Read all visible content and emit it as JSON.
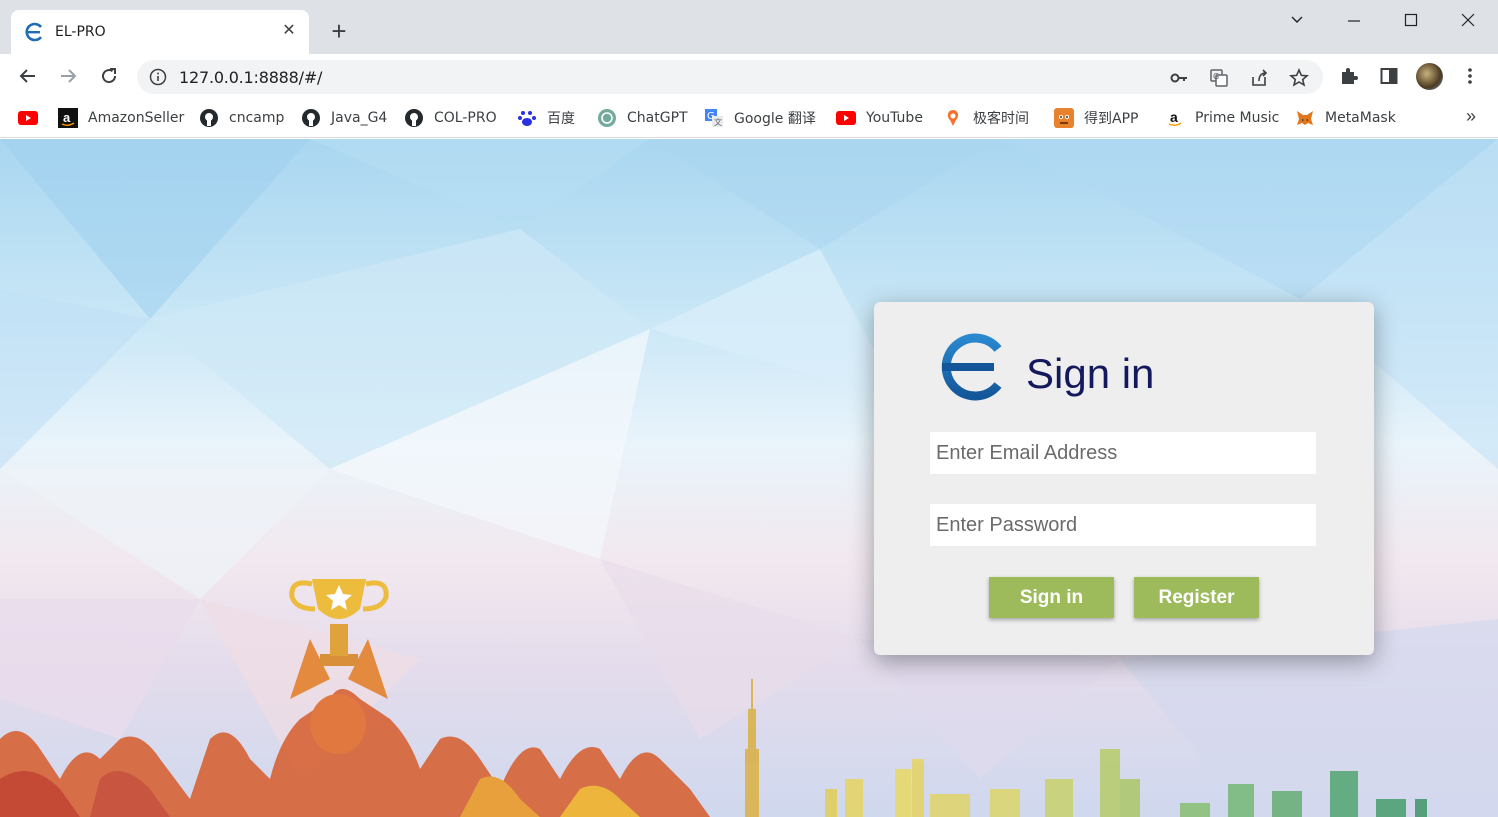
{
  "browser": {
    "tab": {
      "title": "EL-PRO",
      "close_glyph": "✕"
    },
    "new_tab_glyph": "+",
    "address": {
      "url": "127.0.0.1:8888/#/"
    },
    "bookmarks": [
      {
        "label": "",
        "icon": "youtube-icon"
      },
      {
        "label": "AmazonSeller",
        "icon": "amazon-icon"
      },
      {
        "label": "cncamp",
        "icon": "github-icon"
      },
      {
        "label": "Java_G4",
        "icon": "github-icon"
      },
      {
        "label": "COL-PRO",
        "icon": "github-icon"
      },
      {
        "label": "百度",
        "icon": "baidu-icon"
      },
      {
        "label": "ChatGPT",
        "icon": "chatgpt-icon"
      },
      {
        "label": "Google 翻译",
        "icon": "google-translate-icon"
      },
      {
        "label": "YouTube",
        "icon": "youtube-icon"
      },
      {
        "label": "极客时间",
        "icon": "geektime-icon"
      },
      {
        "label": "得到APP",
        "icon": "dedao-icon"
      },
      {
        "label": "Prime Music",
        "icon": "amazon-icon"
      },
      {
        "label": "MetaMask",
        "icon": "metamask-icon"
      }
    ],
    "bookmarks_overflow": "»"
  },
  "login": {
    "title": "Sign in",
    "email_placeholder": "Enter Email Address",
    "password_placeholder": "Enter Password",
    "signin_label": "Sign in",
    "register_label": "Register"
  },
  "colors": {
    "button": "#9dbb5b",
    "title": "#14185c",
    "logo": "#1f6db3"
  }
}
